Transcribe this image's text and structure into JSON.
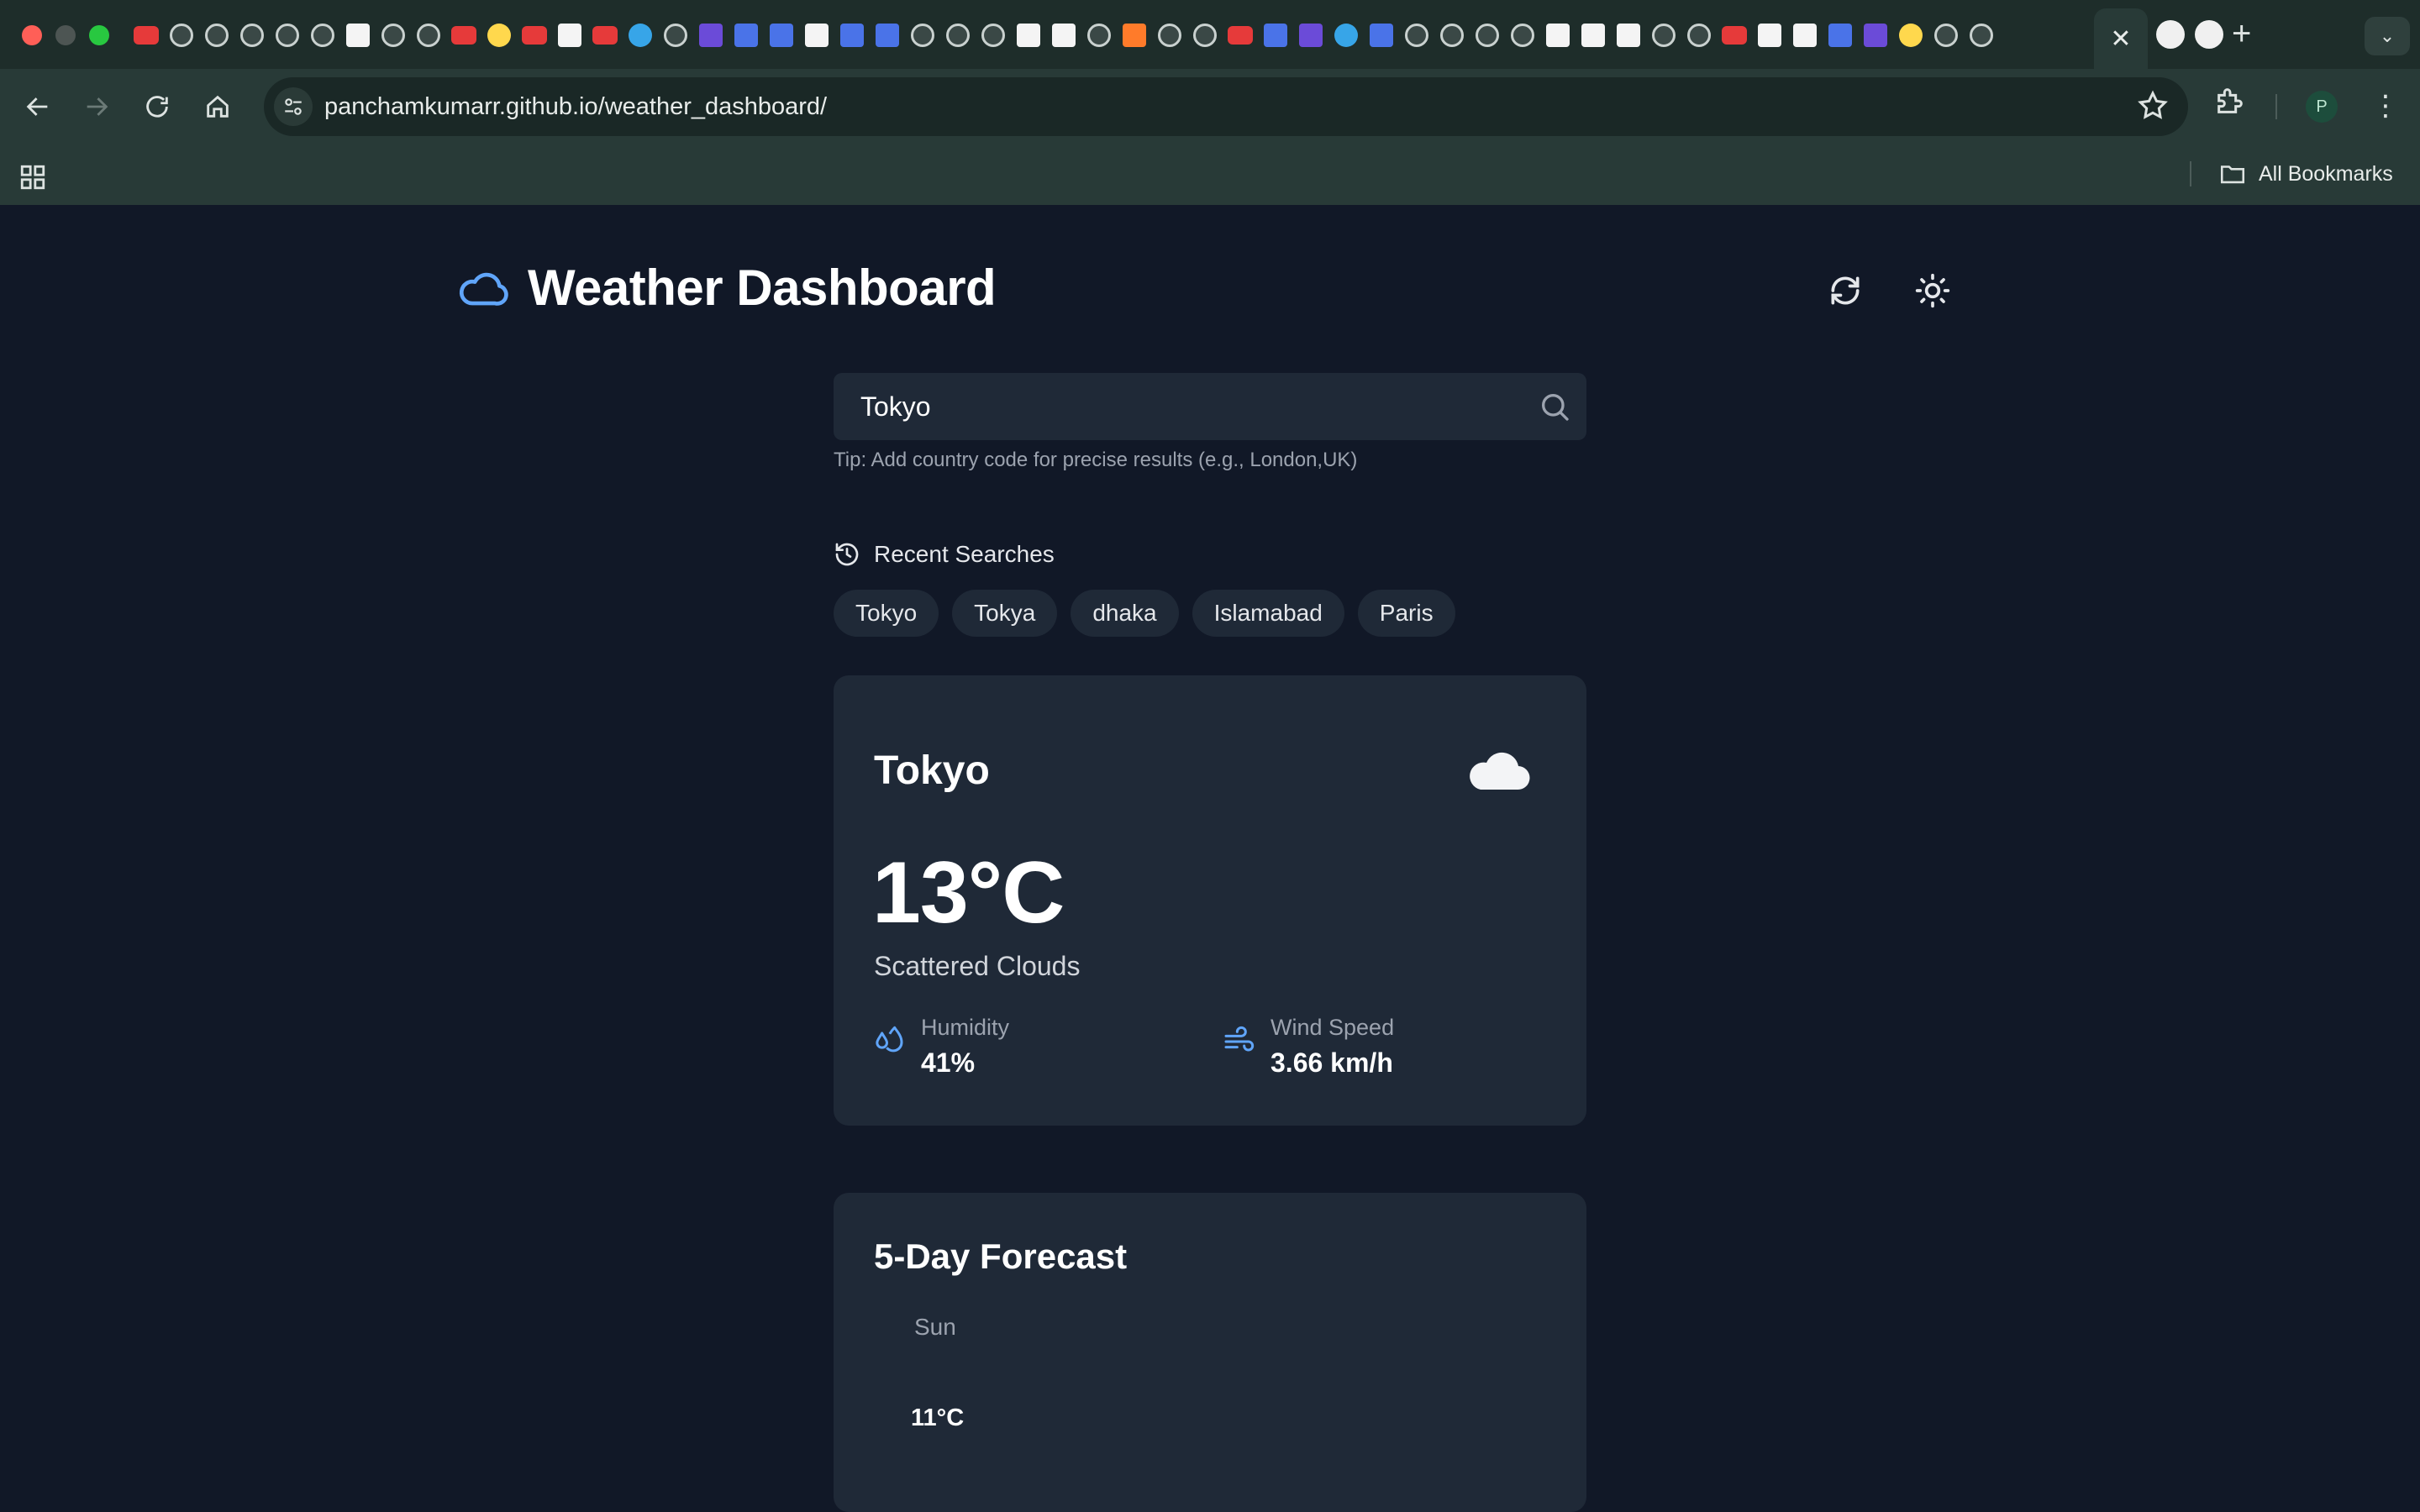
{
  "browser": {
    "url_host": "panchamkumarr.github.io",
    "url_path": "/weather_dashboard/",
    "profile_initial": "P",
    "bookmarks_label": "All Bookmarks",
    "active_tab_close": "✕",
    "new_tab": "+",
    "tab_menu": "⌄",
    "menu": "⋮"
  },
  "app": {
    "title": "Weather Dashboard",
    "accent": "#60a5fa",
    "background": "#111827",
    "card_background": "#1f2937"
  },
  "search": {
    "value": "Tokyo",
    "tip": "Tip: Add country code for precise results (e.g., London,UK)"
  },
  "recent": {
    "heading": "Recent Searches",
    "items": [
      "Tokyo",
      "Tokya",
      "dhaka",
      "Islamabad",
      "Paris"
    ]
  },
  "current": {
    "city": "Tokyo",
    "icon": "cloud-icon",
    "temperature": "13°C",
    "description": "Scattered Clouds",
    "humidity_label": "Humidity",
    "humidity_value": "41%",
    "wind_label": "Wind Speed",
    "wind_value": "3.66 km/h"
  },
  "forecast": {
    "title": "5-Day Forecast",
    "days": [
      {
        "day": "Sun",
        "temp": "11°C"
      }
    ]
  }
}
